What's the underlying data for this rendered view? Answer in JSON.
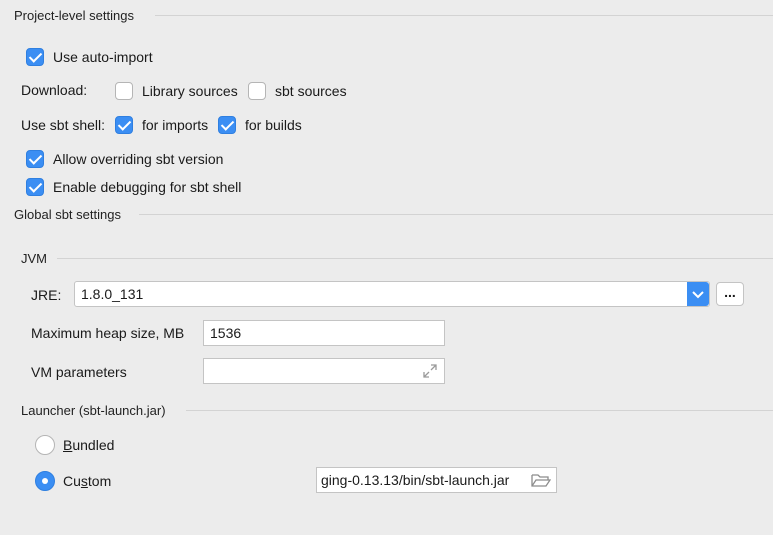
{
  "project": {
    "title": "Project-level settings",
    "use_auto_import": {
      "label": "Use auto-import",
      "checked": true
    },
    "download": {
      "label": "Download:",
      "library_sources": {
        "label": "Library sources",
        "checked": false
      },
      "sbt_sources": {
        "label": "sbt sources",
        "checked": false
      }
    },
    "sbt_shell": {
      "label": "Use sbt shell:",
      "for_imports": {
        "label": "for imports",
        "checked": true
      },
      "for_builds": {
        "label": "for builds",
        "checked": true
      }
    },
    "allow_overriding": {
      "label": "Allow overriding sbt version",
      "checked": true
    },
    "enable_debugging": {
      "label": "Enable debugging for sbt shell",
      "checked": true
    }
  },
  "global": {
    "title": "Global sbt settings",
    "jvm": {
      "title": "JVM",
      "jre_label": "JRE:",
      "jre_value": "1.8.0_131",
      "browse_label": "...",
      "heap_label": "Maximum heap size, MB",
      "heap_value": "1536",
      "vm_label": "VM parameters",
      "vm_value": ""
    },
    "launcher": {
      "title": "Launcher (sbt-launch.jar)",
      "bundled_first": "B",
      "bundled_rest": "undled",
      "custom_first": "Cu",
      "custom_u": "s",
      "custom_rest": "tom",
      "selected": "Custom",
      "custom_path": "ging-0.13.13/bin/sbt-launch.jar"
    }
  },
  "icons": {
    "dropdown": "chevron-down-icon",
    "expand": "expand-icon",
    "folder": "folder-icon"
  },
  "colors": {
    "accent": "#3b8ef3",
    "background": "#ececec"
  }
}
